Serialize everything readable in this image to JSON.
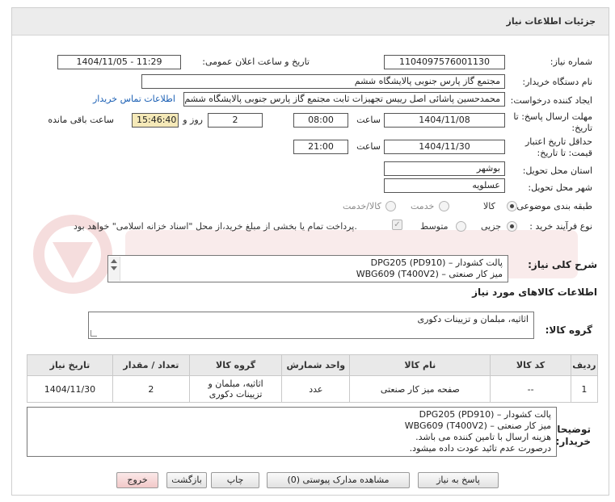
{
  "header": {
    "title": "جزئیات اطلاعات نیاز"
  },
  "fields": {
    "need_number_label": "شماره نیاز:",
    "need_number": "1104097576001130",
    "announce_label": "تاریخ و ساعت اعلان عمومی:",
    "announce_value": "1404/11/05 - 11:29",
    "buyer_org_label": "نام دستگاه خریدار:",
    "buyer_org": "مجتمع گاز پارس جنوبی  پالایشگاه ششم",
    "requester_label": "ایجاد کننده درخواست:",
    "requester": "محمدحسین پاشائی اصل رییس تجهیزات ثابت مجتمع گاز پارس جنوبی  پالایشگاه ششم",
    "contact_link": "اطلاعات تماس خریدار",
    "deadline_label_1": "مهلت ارسال پاسخ: تا",
    "deadline_label_2": "تاریخ:",
    "deadline_date": "1404/11/08",
    "time_label": "ساعت",
    "deadline_time": "08:00",
    "days_value": "2",
    "days_label": "روز و",
    "remaining_time": "15:46:40",
    "remaining_label": "ساعت باقی مانده",
    "validity_label_1": "حداقل تاریخ اعتبار",
    "validity_label_2": "قیمت: تا تاریخ:",
    "validity_date": "1404/11/30",
    "validity_time": "21:00",
    "province_label": "استان محل تحویل:",
    "province": "بوشهر",
    "city_label": "شهر محل تحویل:",
    "city": "عسلویه",
    "category_label": "طبقه بندی موضوعی:",
    "category_options": [
      "کالا",
      "خدمت",
      "کالا/خدمت"
    ],
    "process_label": "نوع فرآیند خرید :",
    "process_options": [
      "جزیی",
      "متوسط"
    ],
    "payment_note": "پرداخت تمام یا بخشی از مبلغ خرید،از محل \"اسناد خزانه اسلامی\" خواهد بود."
  },
  "general_desc": {
    "label": "شرح کلی نیاز:",
    "lines": [
      "پالت کشودار – DPG205 (PD910)",
      "میز کار صنعتی – WBG609 (T400V2)"
    ]
  },
  "goods_info_title": "اطلاعات کالاهای مورد نیاز",
  "goods_group": {
    "label": "گروه کالا:",
    "value": "اثاثیه، مبلمان و تزیینات دکوری"
  },
  "table": {
    "headers": [
      "ردیف",
      "کد کالا",
      "نام کالا",
      "واحد شمارش",
      "گروه کالا",
      "تعداد / مقدار",
      "تاریخ نیاز"
    ],
    "rows": [
      {
        "row": "1",
        "code": "--",
        "name": "صفحه میز کار صنعتی",
        "unit": "عدد",
        "group_1": "اثاثیه، مبلمان و",
        "group_2": "تزیینات دکوری",
        "qty": "2",
        "date": "1404/11/30"
      }
    ]
  },
  "buyer_notes": {
    "label_1": "توضیحات",
    "label_2": "خریدار:",
    "lines": [
      "پالت کشودار – DPG205 (PD910)",
      "میز کار صنعتی – WBG609 (T400V2)",
      "هزینه ارسال با تامین کننده می باشد.",
      "درصورت عدم تائید عودت داده میشود."
    ]
  },
  "buttons": {
    "reply": "پاسخ به نیاز",
    "attachments": "مشاهده مدارک پیوستی (0)",
    "print": "چاپ",
    "back": "بازگشت",
    "exit": "خروج"
  },
  "colors": {
    "header_bg": "#ececec",
    "time_bg": "#f5e9b8",
    "link": "#1a5fb4",
    "exit_bg": "#f2c9c9"
  }
}
